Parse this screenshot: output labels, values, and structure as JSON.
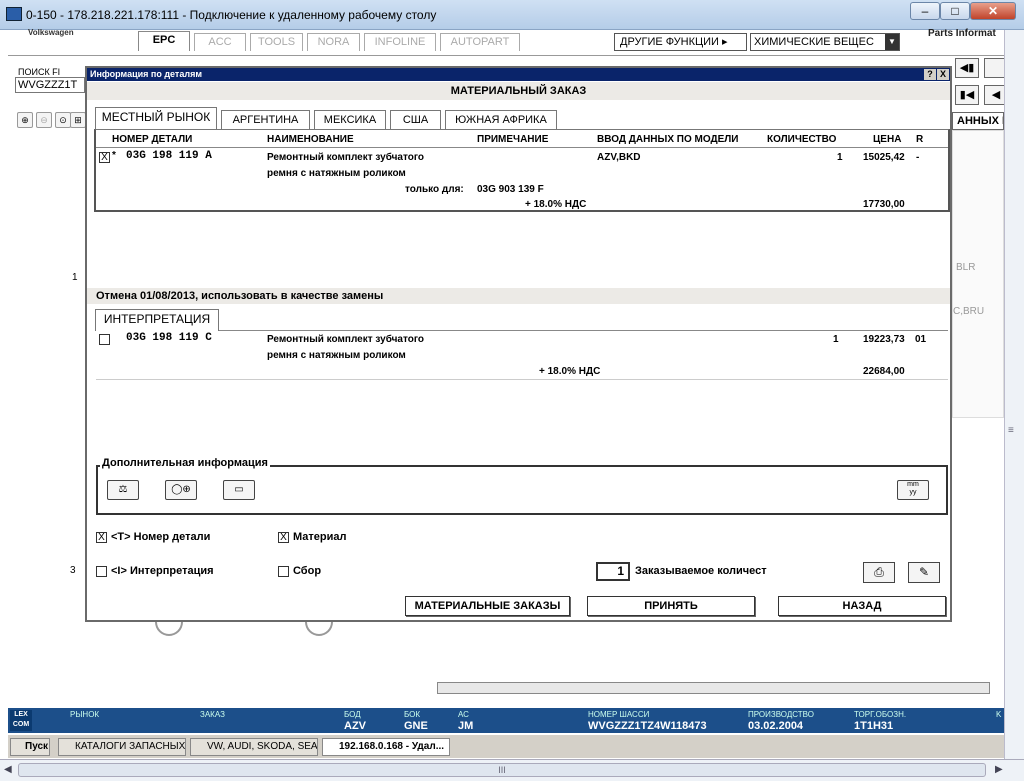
{
  "window": {
    "title": "0-150 - 178.218.221.178:111 - Подключение к удаленному рабочему столу",
    "minimize": "–",
    "maximize": "□",
    "close": "✕"
  },
  "app": {
    "brand": "Volkswagen",
    "parts_info": "Parts Informat",
    "tabs": [
      "EPC",
      "ACC",
      "TOOLS",
      "NORA",
      "INFOLINE",
      "AUTOPART"
    ],
    "other_functions": "ДРУГИЕ ФУНКЦИИ ▸",
    "chemicals_select": "ХИМИЧЕСКИЕ ВЕЩЕС",
    "search_label": "ПОИСК FI",
    "search_value": "WVGZZZ1T",
    "right_label": "АННЫХ П",
    "bg_codes": [
      "BLR",
      "C,BRU"
    ],
    "side_nums": [
      "1",
      "3"
    ]
  },
  "dialog": {
    "title": "Информация по деталям",
    "help": "?",
    "close": "X",
    "header": "МАТЕРИАЛЬНЫЙ ЗАКАЗ",
    "market_tabs": [
      "МЕСТНЫЙ РЫНОК",
      "АРГЕНТИНА",
      "МЕКСИКА",
      "США",
      "ЮЖНАЯ АФРИКА"
    ],
    "columns": [
      "НОМЕР ДЕТАЛИ",
      "НАИМЕНОВАНИЕ",
      "ПРИМЕЧАНИЕ",
      "ВВОД ДАННЫХ ПО МОДЕЛИ",
      "КОЛИЧЕСТВО",
      "ЦЕНА",
      "R"
    ],
    "row1": {
      "checked": "X",
      "star": "*",
      "part": "03G 198 119 A",
      "name1": "Ремонтный комплект зубчатого",
      "name2": "ремня с натяжным роликом",
      "model": "AZV,BKD",
      "qty": "1",
      "price": "15025,42",
      "r": "-",
      "only_for_label": "только для:",
      "only_for_value": "03G 903 139 F",
      "vat": "+ 18.0% НДС",
      "price_vat": "17730,00"
    },
    "cancel_note": "Отмена 01/08/2013, использовать в качестве замены",
    "interp_tab": "ИНТЕРПРЕТАЦИЯ",
    "row2": {
      "part": "03G 198 119 C",
      "name1": "Ремонтный комплект зубчатого",
      "name2": "ремня с натяжным роликом",
      "qty": "1",
      "price": "19223,73",
      "r": "01",
      "vat": "+ 18.0% НДС",
      "price_vat": "22684,00"
    },
    "additional_info": "Дополнительная информация",
    "mm_yy": "mm\nyy",
    "options": {
      "part_number": "<T> Номер детали",
      "material": "Материал",
      "interpretation": "<I> Интерпретация",
      "assembly": "Сбор",
      "part_checked": "X",
      "material_checked": "X"
    },
    "qty_value": "1",
    "qty_label": "Заказываемое количест",
    "buttons": {
      "material_orders": "МАТЕРИАЛЬНЫЕ ЗАКАЗЫ",
      "accept": "ПРИНЯТЬ",
      "back": "НАЗАД"
    }
  },
  "status": {
    "lexcom": "LEX COM",
    "market_label": "РЫНОК",
    "order_label": "ЗАКАЗ",
    "bod_label": "БОД",
    "bod_value": "AZV",
    "bok_label": "БОК",
    "bok_value": "GNE",
    "ac_label": "АС",
    "ac_value": "JM",
    "chassis_label": "НОМЕР ШАССИ",
    "chassis_value": "WVGZZZ1TZ4W118473",
    "prod_label": "ПРОИЗВОДСТВО",
    "prod_value": "03.02.2004",
    "trade_label": "ТОРГ.ОБОЗН.",
    "trade_value": "1T1H31",
    "edge_k": "K"
  },
  "taskbar": {
    "start": "Пуск",
    "items": [
      "КАТАЛОГИ ЗАПАСНЫХ ...",
      "VW, AUDI, SKODA, SEAT",
      "192.168.0.168 - Удал..."
    ]
  },
  "scroll": {
    "grip": "III"
  }
}
